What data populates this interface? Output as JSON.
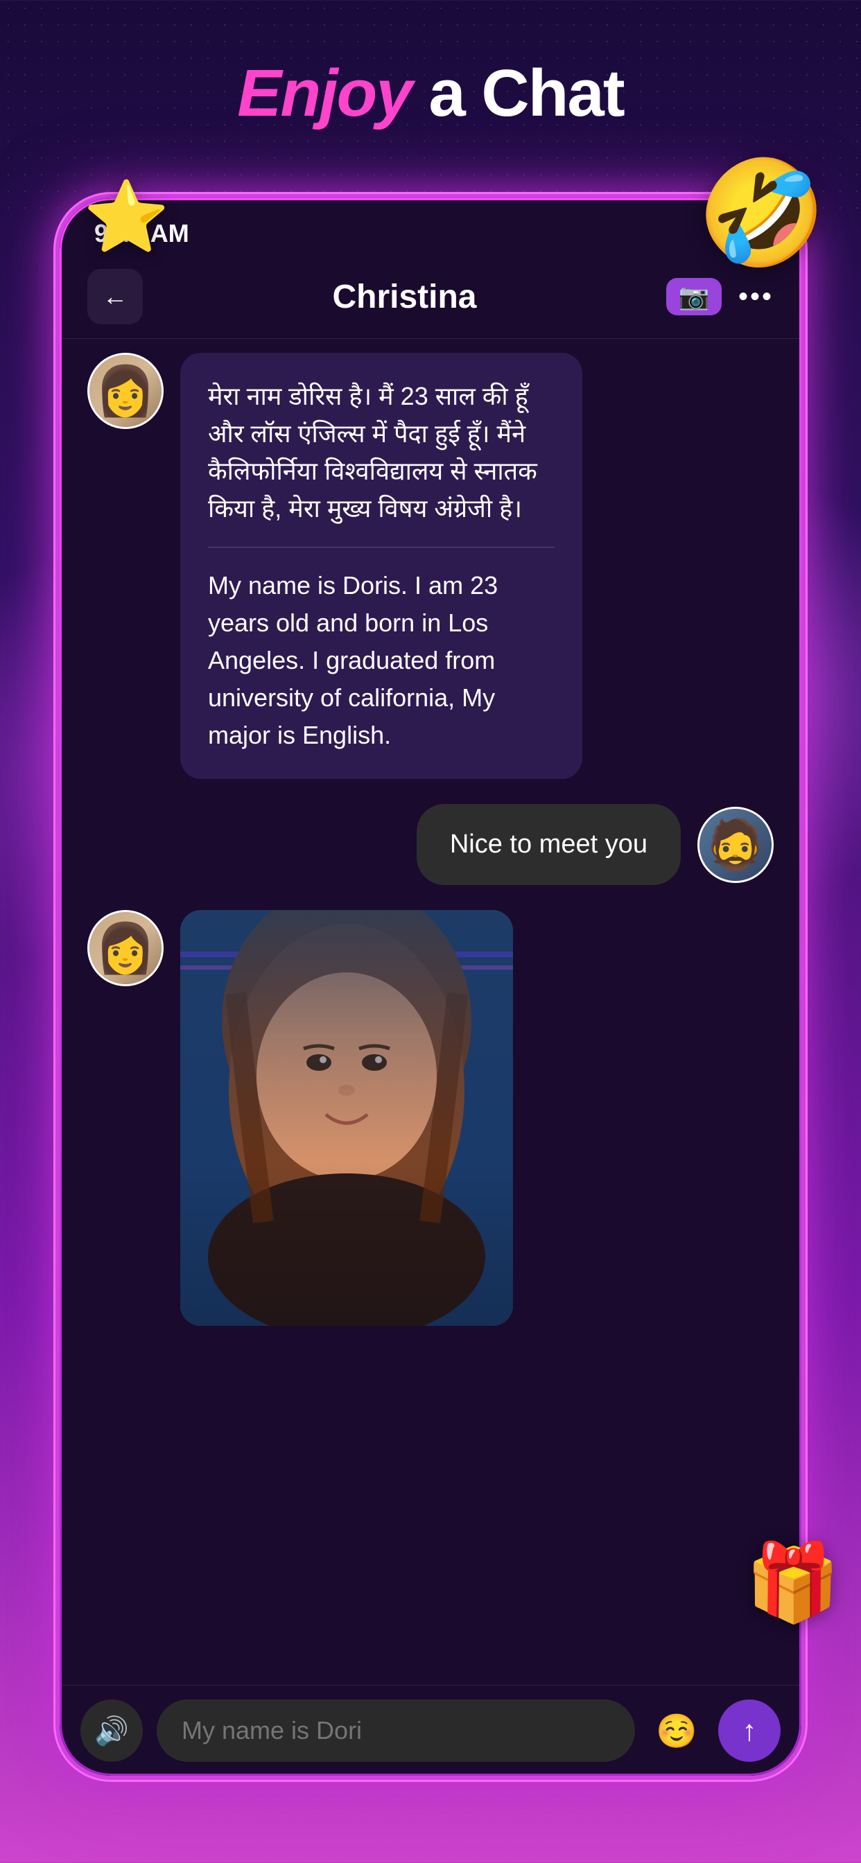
{
  "page": {
    "title_enjoy": "Enjoy",
    "title_rest": " a Chat"
  },
  "status_bar": {
    "time": "9:41 AM"
  },
  "header": {
    "chat_name": "Christina",
    "back_label": "←",
    "video_label": "🎥",
    "more_label": "•••"
  },
  "messages": [
    {
      "type": "received",
      "text_hindi": "मेरा नाम डोरिस है। मैं 23 साल की हूँ और लॉस एंजिल्स में पैदा हुई हूँ। मैंने कैलिफोर्निया विश्वविद्यालय से स्नातक किया है, मेरा मुख्य विषय अंग्रेजी है।",
      "text_english": "My name is Doris. I am 23 years old and born in Los Angeles. I graduated from university of california, My major is English.",
      "sender": "doris"
    },
    {
      "type": "sent",
      "text": "Nice to meet you",
      "sender": "user"
    },
    {
      "type": "received_image",
      "sender": "doris"
    }
  ],
  "input_bar": {
    "placeholder": "My name is Dori",
    "voice_icon": "🔊",
    "emoji_icon": "☺",
    "send_icon": "↑"
  },
  "decorative": {
    "star_emoji": "⭐",
    "laugh_emoji": "🤣",
    "gift_emoji": "🎁"
  },
  "nice_to_meet": "Nice to meet yoU"
}
